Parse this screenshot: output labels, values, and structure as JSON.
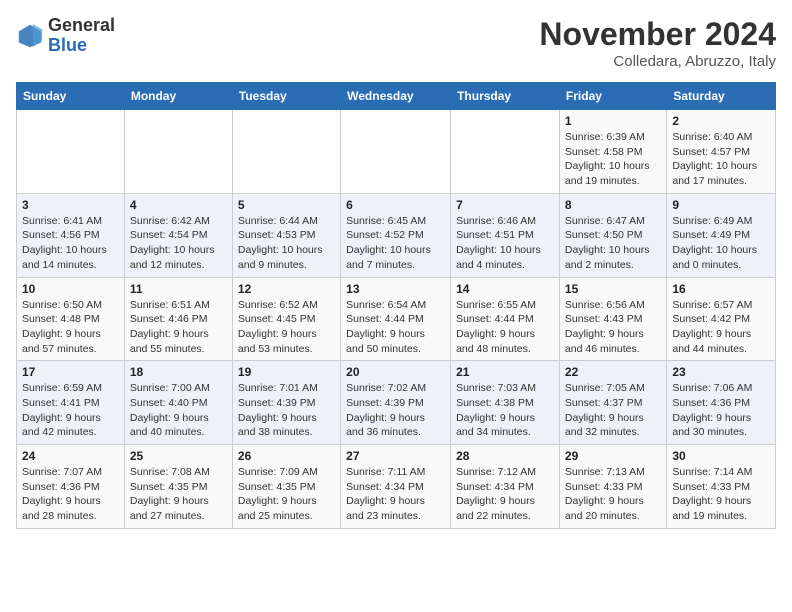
{
  "logo": {
    "line1": "General",
    "line2": "Blue"
  },
  "header": {
    "month": "November 2024",
    "location": "Colledara, Abruzzo, Italy"
  },
  "days_of_week": [
    "Sunday",
    "Monday",
    "Tuesday",
    "Wednesday",
    "Thursday",
    "Friday",
    "Saturday"
  ],
  "weeks": [
    [
      {
        "day": "",
        "info": ""
      },
      {
        "day": "",
        "info": ""
      },
      {
        "day": "",
        "info": ""
      },
      {
        "day": "",
        "info": ""
      },
      {
        "day": "",
        "info": ""
      },
      {
        "day": "1",
        "info": "Sunrise: 6:39 AM\nSunset: 4:58 PM\nDaylight: 10 hours and 19 minutes."
      },
      {
        "day": "2",
        "info": "Sunrise: 6:40 AM\nSunset: 4:57 PM\nDaylight: 10 hours and 17 minutes."
      }
    ],
    [
      {
        "day": "3",
        "info": "Sunrise: 6:41 AM\nSunset: 4:56 PM\nDaylight: 10 hours and 14 minutes."
      },
      {
        "day": "4",
        "info": "Sunrise: 6:42 AM\nSunset: 4:54 PM\nDaylight: 10 hours and 12 minutes."
      },
      {
        "day": "5",
        "info": "Sunrise: 6:44 AM\nSunset: 4:53 PM\nDaylight: 10 hours and 9 minutes."
      },
      {
        "day": "6",
        "info": "Sunrise: 6:45 AM\nSunset: 4:52 PM\nDaylight: 10 hours and 7 minutes."
      },
      {
        "day": "7",
        "info": "Sunrise: 6:46 AM\nSunset: 4:51 PM\nDaylight: 10 hours and 4 minutes."
      },
      {
        "day": "8",
        "info": "Sunrise: 6:47 AM\nSunset: 4:50 PM\nDaylight: 10 hours and 2 minutes."
      },
      {
        "day": "9",
        "info": "Sunrise: 6:49 AM\nSunset: 4:49 PM\nDaylight: 10 hours and 0 minutes."
      }
    ],
    [
      {
        "day": "10",
        "info": "Sunrise: 6:50 AM\nSunset: 4:48 PM\nDaylight: 9 hours and 57 minutes."
      },
      {
        "day": "11",
        "info": "Sunrise: 6:51 AM\nSunset: 4:46 PM\nDaylight: 9 hours and 55 minutes."
      },
      {
        "day": "12",
        "info": "Sunrise: 6:52 AM\nSunset: 4:45 PM\nDaylight: 9 hours and 53 minutes."
      },
      {
        "day": "13",
        "info": "Sunrise: 6:54 AM\nSunset: 4:44 PM\nDaylight: 9 hours and 50 minutes."
      },
      {
        "day": "14",
        "info": "Sunrise: 6:55 AM\nSunset: 4:44 PM\nDaylight: 9 hours and 48 minutes."
      },
      {
        "day": "15",
        "info": "Sunrise: 6:56 AM\nSunset: 4:43 PM\nDaylight: 9 hours and 46 minutes."
      },
      {
        "day": "16",
        "info": "Sunrise: 6:57 AM\nSunset: 4:42 PM\nDaylight: 9 hours and 44 minutes."
      }
    ],
    [
      {
        "day": "17",
        "info": "Sunrise: 6:59 AM\nSunset: 4:41 PM\nDaylight: 9 hours and 42 minutes."
      },
      {
        "day": "18",
        "info": "Sunrise: 7:00 AM\nSunset: 4:40 PM\nDaylight: 9 hours and 40 minutes."
      },
      {
        "day": "19",
        "info": "Sunrise: 7:01 AM\nSunset: 4:39 PM\nDaylight: 9 hours and 38 minutes."
      },
      {
        "day": "20",
        "info": "Sunrise: 7:02 AM\nSunset: 4:39 PM\nDaylight: 9 hours and 36 minutes."
      },
      {
        "day": "21",
        "info": "Sunrise: 7:03 AM\nSunset: 4:38 PM\nDaylight: 9 hours and 34 minutes."
      },
      {
        "day": "22",
        "info": "Sunrise: 7:05 AM\nSunset: 4:37 PM\nDaylight: 9 hours and 32 minutes."
      },
      {
        "day": "23",
        "info": "Sunrise: 7:06 AM\nSunset: 4:36 PM\nDaylight: 9 hours and 30 minutes."
      }
    ],
    [
      {
        "day": "24",
        "info": "Sunrise: 7:07 AM\nSunset: 4:36 PM\nDaylight: 9 hours and 28 minutes."
      },
      {
        "day": "25",
        "info": "Sunrise: 7:08 AM\nSunset: 4:35 PM\nDaylight: 9 hours and 27 minutes."
      },
      {
        "day": "26",
        "info": "Sunrise: 7:09 AM\nSunset: 4:35 PM\nDaylight: 9 hours and 25 minutes."
      },
      {
        "day": "27",
        "info": "Sunrise: 7:11 AM\nSunset: 4:34 PM\nDaylight: 9 hours and 23 minutes."
      },
      {
        "day": "28",
        "info": "Sunrise: 7:12 AM\nSunset: 4:34 PM\nDaylight: 9 hours and 22 minutes."
      },
      {
        "day": "29",
        "info": "Sunrise: 7:13 AM\nSunset: 4:33 PM\nDaylight: 9 hours and 20 minutes."
      },
      {
        "day": "30",
        "info": "Sunrise: 7:14 AM\nSunset: 4:33 PM\nDaylight: 9 hours and 19 minutes."
      }
    ]
  ]
}
